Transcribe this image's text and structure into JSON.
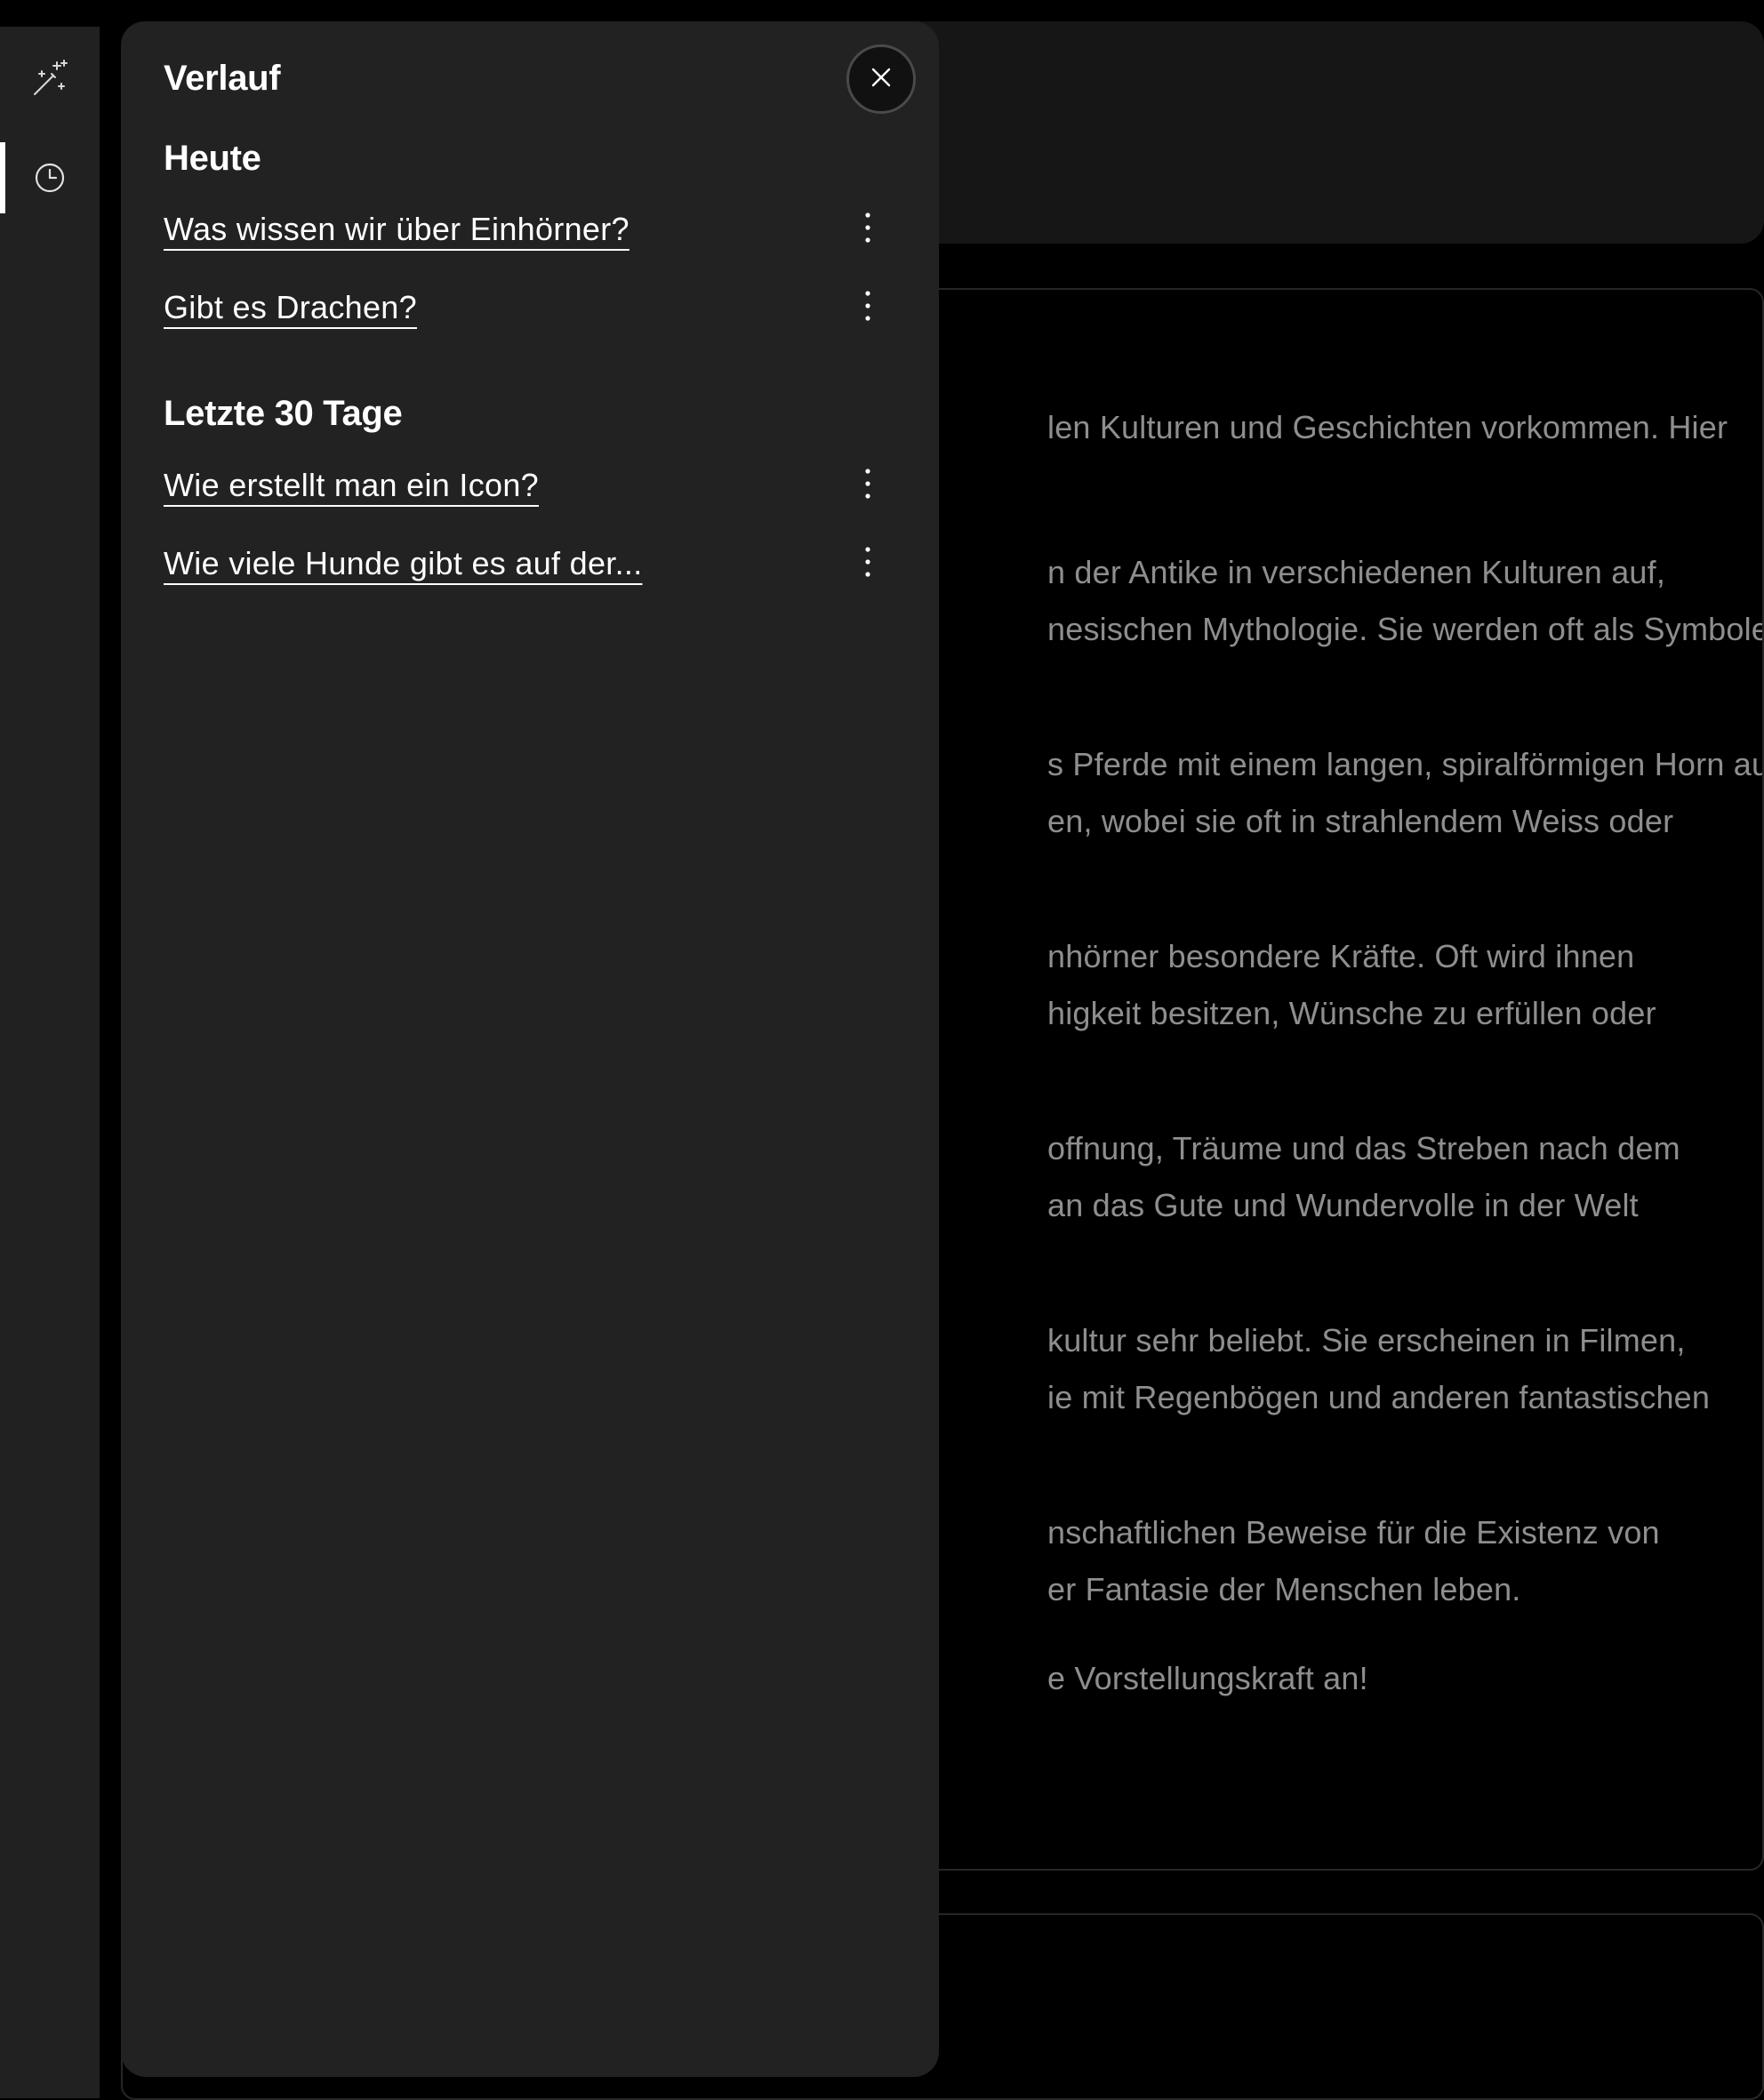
{
  "rail": {
    "items": [
      {
        "name": "magic-wand-icon",
        "active": false
      },
      {
        "name": "history-clock-icon",
        "active": true
      }
    ]
  },
  "history": {
    "title": "Verlauf",
    "close_icon": "close-icon",
    "sections": [
      {
        "title": "Heute",
        "items": [
          {
            "label": "Was wissen wir über Einhörner?"
          },
          {
            "label": "Gibt es Drachen?"
          }
        ]
      },
      {
        "title": "Letzte 30 Tage",
        "items": [
          {
            "label": "Wie erstellt man ein Icon?"
          },
          {
            "label": "Wie viele Hunde gibt es auf der..."
          }
        ]
      }
    ]
  },
  "answer": {
    "lines": [
      "len Kulturen und Geschichten vorkommen. Hier",
      "n der Antike in verschiedenen Kulturen auf,",
      "nesischen Mythologie. Sie werden oft als Symbole",
      "s Pferde mit einem langen, spiralförmigen Horn auf",
      "en, wobei sie oft in strahlendem Weiss oder",
      "nhörner besondere Kräfte. Oft wird ihnen",
      "higkeit besitzen, Wünsche zu erfüllen oder",
      "offnung, Träume und das Streben nach dem",
      " an das Gute und Wundervolle in der Welt",
      "kultur sehr beliebt. Sie erscheinen in Filmen,",
      "ie mit Regenbögen und anderen fantastischen",
      "nschaftlichen Beweise für die Existenz von",
      "er Fantasie der Menschen leben.",
      "e Vorstellungskraft an!"
    ]
  },
  "colors": {
    "panel_bg": "#222222",
    "rail_bg": "#212121",
    "page_bg": "#000000",
    "text_primary": "#ffffff",
    "text_dimmed": "#8e8e8e"
  }
}
